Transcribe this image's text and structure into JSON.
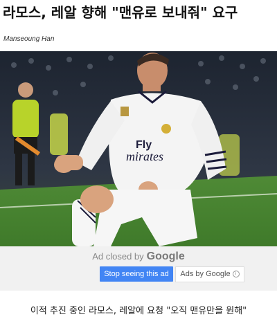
{
  "article": {
    "headline": "라모스, 레알 향해 \"맨유로 보내줘\" 요구",
    "author": "Manseoung Han",
    "subheadline": "이적 추진 중인 라모스, 레알에 요청 \"오직 맨유만을 원해\""
  },
  "photo": {
    "jersey_sponsor_line1": "Fly",
    "jersey_sponsor_line2": "mirates"
  },
  "ad": {
    "closed_label": "Ad closed by",
    "google_label": "Google",
    "stop_button": "Stop seeing this ad",
    "ads_by_label": "Ads by Google",
    "info_glyph": "i",
    "accent_color": "#4285f4"
  }
}
